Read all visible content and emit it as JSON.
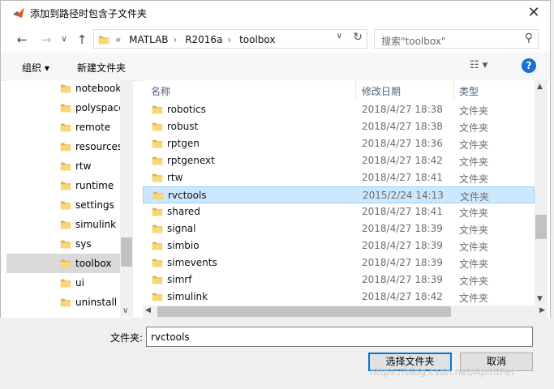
{
  "window": {
    "title": "添加到路径时包含子文件夹",
    "close_glyph": "✕"
  },
  "nav": {
    "back": "←",
    "forward": "→",
    "recent": "∨",
    "up": "↑",
    "breadcrumb_prefix": "«",
    "breadcrumbs": [
      "MATLAB",
      "R2016a",
      "toolbox"
    ],
    "refresh": "↻",
    "search_placeholder": "搜索\"toolbox\"",
    "search_icon": "⚲"
  },
  "toolbar": {
    "organize": "组织 ▾",
    "new_folder": "新建文件夹",
    "view_glyph": "☷ ▾",
    "help": "?"
  },
  "sidebar": {
    "items": [
      {
        "label": "notebook",
        "selected": false
      },
      {
        "label": "polyspace",
        "selected": false
      },
      {
        "label": "remote",
        "selected": false
      },
      {
        "label": "resources",
        "selected": false
      },
      {
        "label": "rtw",
        "selected": false
      },
      {
        "label": "runtime",
        "selected": false
      },
      {
        "label": "settings",
        "selected": false
      },
      {
        "label": "simulink",
        "selected": false
      },
      {
        "label": "sys",
        "selected": false
      },
      {
        "label": "toolbox",
        "selected": true
      },
      {
        "label": "ui",
        "selected": false
      },
      {
        "label": "uninstall",
        "selected": false
      }
    ]
  },
  "filelist": {
    "columns": {
      "name": "名称",
      "date": "修改日期",
      "type": "类型"
    },
    "sort_arrow": "^",
    "rows": [
      {
        "name": "robotics",
        "date": "2018/4/27 18:38",
        "type": "文件夹",
        "selected": false
      },
      {
        "name": "robust",
        "date": "2018/4/27 18:38",
        "type": "文件夹",
        "selected": false
      },
      {
        "name": "rptgen",
        "date": "2018/4/27 18:36",
        "type": "文件夹",
        "selected": false
      },
      {
        "name": "rptgenext",
        "date": "2018/4/27 18:42",
        "type": "文件夹",
        "selected": false
      },
      {
        "name": "rtw",
        "date": "2018/4/27 18:41",
        "type": "文件夹",
        "selected": false
      },
      {
        "name": "rvctools",
        "date": "2015/2/24 14:13",
        "type": "文件夹",
        "selected": true
      },
      {
        "name": "shared",
        "date": "2018/4/27 18:41",
        "type": "文件夹",
        "selected": false
      },
      {
        "name": "signal",
        "date": "2018/4/27 18:39",
        "type": "文件夹",
        "selected": false
      },
      {
        "name": "simbio",
        "date": "2018/4/27 18:39",
        "type": "文件夹",
        "selected": false
      },
      {
        "name": "simevents",
        "date": "2018/4/27 18:39",
        "type": "文件夹",
        "selected": false
      },
      {
        "name": "simrf",
        "date": "2018/4/27 18:39",
        "type": "文件夹",
        "selected": false
      },
      {
        "name": "simulink",
        "date": "2018/4/27 18:42",
        "type": "文件夹",
        "selected": false
      }
    ]
  },
  "footer": {
    "folder_label": "文件夹:",
    "folder_value": "rvctools",
    "select_button": "选择文件夹",
    "cancel_button": "取消"
  },
  "watermark": "https://blog.csdn.net/ApititFei",
  "colors": {
    "selection": "#cce8ff",
    "folder": "#f5c542",
    "accent": "#0078d7"
  }
}
